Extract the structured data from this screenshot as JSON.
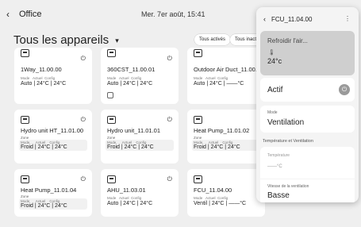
{
  "header": {
    "back_icon": "‹",
    "location": "Office",
    "datetime": "Mer. 7er août, 15:41"
  },
  "page": {
    "title": "Tous les appareils",
    "title_caret": "▾",
    "filters": [
      "Tous activés",
      "Tous inactifs"
    ]
  },
  "devices": [
    {
      "name": "1Way_11.00.00",
      "mode": "Auto",
      "actual": "24°C",
      "config": "24°C"
    },
    {
      "name": "360CST_11.00.01",
      "mode": "Auto",
      "actual": "24°C",
      "config": "24°C"
    },
    {
      "name": "Outdoor Air Duct_11.00.02",
      "mode": "Auto",
      "actual": "24°C",
      "config": "——°C"
    },
    {
      "name": "Hydro unit HT_11.01.00",
      "zone": "Zone",
      "mode": "Froid",
      "actual": "24°C",
      "config": "24°C"
    },
    {
      "name": "Hydro unit_11.01.01",
      "zone": "Zone",
      "mode": "Froid",
      "actual": "24°C",
      "config": "24°C"
    },
    {
      "name": "Heat Pump_11.01.02",
      "zone": "Zone",
      "mode": "Froid",
      "actual": "24°C",
      "config": "24°C"
    },
    {
      "name": "Heat Pump_11.01.04",
      "zone": "Zone",
      "mode": "Froid",
      "actual": "24°C",
      "config": "24°C"
    },
    {
      "name": "AHU_11.03.01",
      "mode": "Auto",
      "actual": "24°C",
      "config": "24°C"
    },
    {
      "name": "FCU_11.04.00",
      "mode": "Ventil",
      "actual": "24°C",
      "config": "——°C"
    }
  ],
  "labels": {
    "mode": "Mode",
    "actual": "Actuel",
    "config": "Config",
    "power": "⏻"
  },
  "panel": {
    "back_icon": "‹",
    "title": "FCU_11.04.00",
    "more_icon": "⋮",
    "action_label": "Refroidir l'air...",
    "thermo_icon": "🌡",
    "action_temp": "24°c",
    "active_label": "Actif",
    "power_icon": "⏻",
    "mode_small": "Mode",
    "mode_value": "Ventilation",
    "section_title": "Température et Ventilation",
    "temp_small": "Température",
    "temp_value": "——°C",
    "fan_small": "Vitesse de la ventilation",
    "fan_value": "Basse"
  }
}
